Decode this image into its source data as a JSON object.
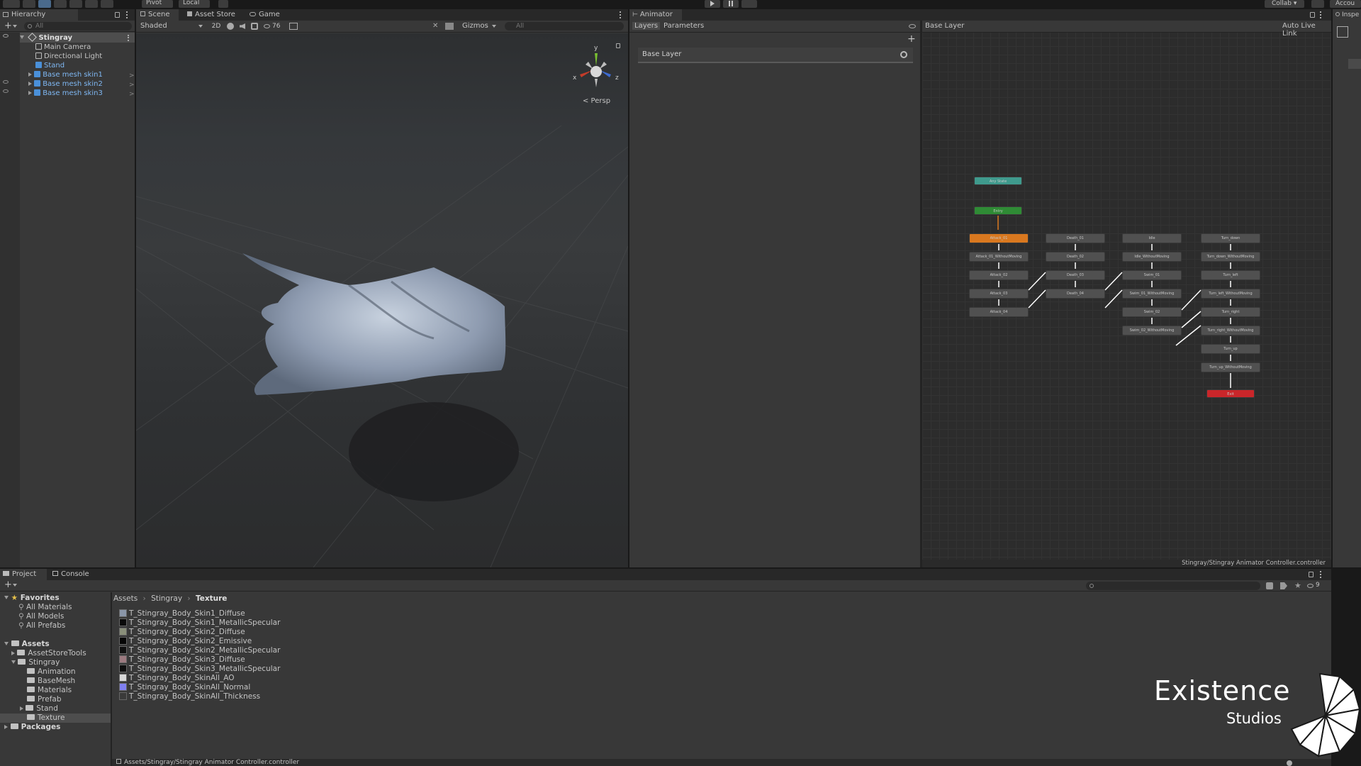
{
  "toolbar": {
    "pivot_label": "Pivot",
    "local_label": "Local",
    "collab_label": "Collab ▾",
    "account_label": "Accou"
  },
  "hierarchy": {
    "tab_label": "Hierarchy",
    "search_placeholder": "All",
    "root": "Stingray",
    "items": [
      {
        "label": "Main Camera",
        "prefab": false
      },
      {
        "label": "Directional Light",
        "prefab": false
      },
      {
        "label": "Stand",
        "prefab": true
      },
      {
        "label": "Base mesh skin1",
        "prefab": true
      },
      {
        "label": "Base mesh skin2",
        "prefab": true
      },
      {
        "label": "Base mesh skin3",
        "prefab": true
      }
    ]
  },
  "scene": {
    "tabs": [
      "Scene",
      "Asset Store",
      "Game"
    ],
    "shading_mode": "Shaded",
    "mode_2d": "2D",
    "hidden_count": "76",
    "gizmos_label": "Gizmos",
    "search_placeholder": "All",
    "axis_y": "y",
    "axis_x": "x",
    "axis_z": "z",
    "projection_label": "< Persp"
  },
  "animator": {
    "tab_label": "Animator",
    "layers_tab": "Layers",
    "parameters_tab": "Parameters",
    "breadcrumb": "Base Layer",
    "auto_live_link": "Auto Live Link",
    "layer_name": "Base Layer",
    "footer_path": "Stingray/Stingray Animator Controller.controller",
    "any_state": "Any State",
    "entry": "Entry",
    "exit": "Exit",
    "col1": [
      "Attack_01",
      "Attack_01_WithoutMoving",
      "Attack_02",
      "Attack_03",
      "Attack_04"
    ],
    "col2": [
      "Death_01",
      "Death_02",
      "Death_03",
      "Death_04"
    ],
    "col3": [
      "Idle",
      "Idle_WithoutMoving",
      "Swim_01",
      "Swim_01_WithoutMoving",
      "Swim_02",
      "Swim_02_WithoutMoving"
    ],
    "col4": [
      "Turn_down",
      "Turn_down_WithoutMoving",
      "Turn_left",
      "Turn_left_WithoutMoving",
      "Turn_right",
      "Turn_right_WithoutMoving",
      "Turn_up",
      "Turn_up_WithoutMoving"
    ],
    "colors": {
      "any_state": "#3f9a8d",
      "entry": "#2f8b35",
      "exit": "#c9262a",
      "default_state": "#d9781f"
    }
  },
  "inspector": {
    "tab_label": "Inspe"
  },
  "project": {
    "tabs": [
      "Project",
      "Console"
    ],
    "favorites_label": "Favorites",
    "favorites": [
      "All Materials",
      "All Models",
      "All Prefabs"
    ],
    "assets_label": "Assets",
    "assets_tree": [
      "AssetStoreTools",
      "Stingray"
    ],
    "stingray_children": [
      "Animation",
      "BaseMesh",
      "Materials",
      "Prefab",
      "Stand",
      "Texture"
    ],
    "packages_label": "Packages",
    "breadcrumb": [
      "Assets",
      "Stingray",
      "Texture"
    ],
    "search_placeholder": "",
    "hidden_count": "9",
    "files": [
      {
        "name": "T_Stingray_Body_Skin1_Diffuse",
        "color": "#8a96a8"
      },
      {
        "name": "T_Stingray_Body_Skin1_MetallicSpecular",
        "color": "#0a0a0a"
      },
      {
        "name": "T_Stingray_Body_Skin2_Diffuse",
        "color": "#8a8f7a"
      },
      {
        "name": "T_Stingray_Body_Skin2_Emissive",
        "color": "#060606"
      },
      {
        "name": "T_Stingray_Body_Skin2_MetallicSpecular",
        "color": "#101010"
      },
      {
        "name": "T_Stingray_Body_Skin3_Diffuse",
        "color": "#9c7a80"
      },
      {
        "name": "T_Stingray_Body_Skin3_MetallicSpecular",
        "color": "#0e0e0e"
      },
      {
        "name": "T_Stingray_Body_SkinAll_AO",
        "color": "#d8d8d8"
      },
      {
        "name": "T_Stingray_Body_SkinAll_Normal",
        "color": "#8080f0"
      },
      {
        "name": "T_Stingray_Body_SkinAll_Thickness",
        "color": "#3a3a3a"
      }
    ],
    "status_path": "Assets/Stingray/Stingray Animator Controller.controller"
  },
  "watermark": {
    "line1": "Existence",
    "line2": "Studios"
  }
}
